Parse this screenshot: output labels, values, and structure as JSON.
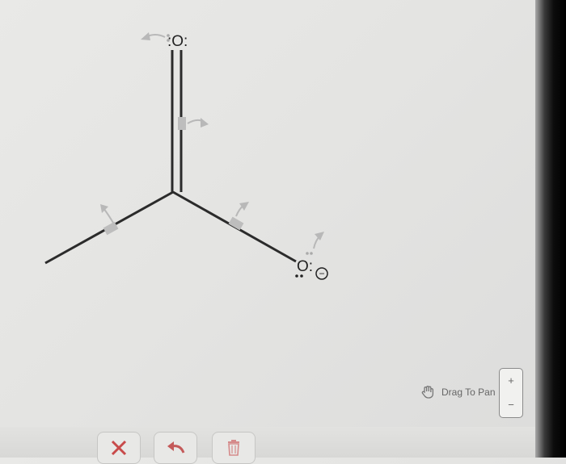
{
  "molecule": {
    "carbonyl_o": ":O:",
    "anion_o": "O:",
    "lone_pair_left": ":",
    "charge": "−"
  },
  "controls": {
    "drag_to_pan": "Drag To Pan",
    "zoom_in": "+",
    "zoom_out": "−"
  },
  "toolbar": {
    "clear_icon": "x-icon",
    "undo_icon": "undo-arrow-icon",
    "delete_icon": "trash-icon"
  },
  "colors": {
    "bond": "#2b2b2b",
    "arrow": "#b8b8b8",
    "clear_red": "#c84a4a",
    "undo_red": "#c45a5a"
  }
}
